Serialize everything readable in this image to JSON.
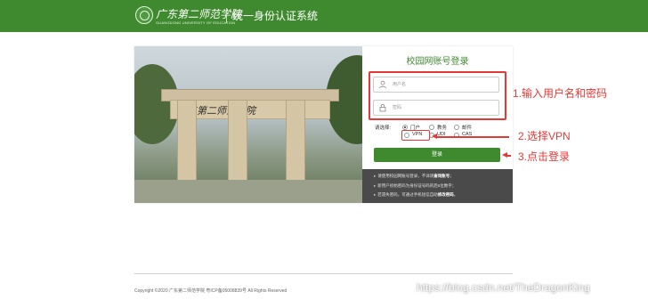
{
  "header": {
    "logo_cn": "广东第二师范学院",
    "logo_en": "GUANGDONG UNIVERSITY OF EDUCATION",
    "title": "统一身份认证系统"
  },
  "photo": {
    "gate_name": "广东第二师范学院"
  },
  "login": {
    "title": "校园网账号登录",
    "username_placeholder": "用户名",
    "password_placeholder": "密码",
    "choose_label": "请选择:",
    "options": [
      "门户",
      "教务",
      "邮件",
      "VPN",
      "UDI",
      "CAS"
    ],
    "selected_option": "门户",
    "button_label": "登录"
  },
  "info": {
    "line1_prefix": "请使用校园网账号登录，不详请",
    "line1_link": "查询账号",
    "line1_suffix": "；",
    "line2": "新用户初始密码为身份证号码的后6位数字；",
    "line3_prefix": "若遗失密码，可通过手机短信自助",
    "line3_link": "修改密码",
    "line3_suffix": "。"
  },
  "annotations": {
    "step1": "1.输入用户名和密码",
    "step2": "2.选择VPN",
    "step3": "3.点击登录",
    "color": "#e53935"
  },
  "footer": {
    "copyright": "Copyright ©2020 广东第二师范学院 粤ICP备05008839号 All Rights Reserved",
    "watermark": "https://blog.csdn.net/TheDragonKing"
  },
  "colors": {
    "brand_green": "#3f8a2f",
    "info_panel": "#4a4a4a"
  }
}
